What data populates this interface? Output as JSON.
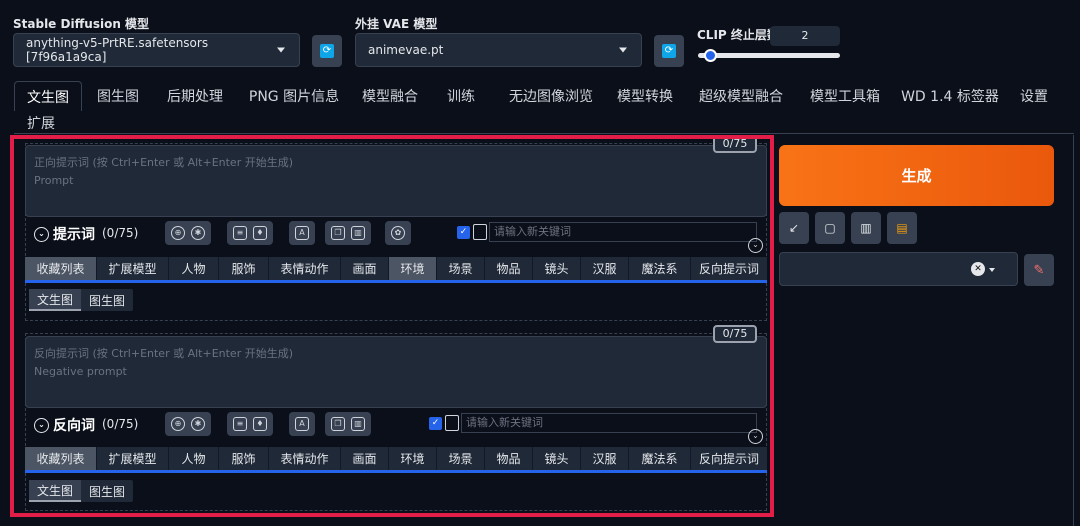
{
  "top": {
    "sd_model_label": "Stable Diffusion 模型",
    "sd_model_value": "anything-v5-PrtRE.safetensors [7f96a1a9ca]",
    "vae_label": "外挂 VAE 模型",
    "vae_value": "animevae.pt",
    "clip_label": "CLIP 终止层数",
    "clip_value": "2"
  },
  "tabs": [
    "文生图",
    "图生图",
    "后期处理",
    "PNG 图片信息",
    "模型融合",
    "训练",
    "无边图像浏览",
    "模型转换",
    "超级模型融合",
    "模型工具箱",
    "WD 1.4 标签器",
    "设置"
  ],
  "tab_extra": "扩展",
  "positive": {
    "counter": "0/75",
    "placeholder_line1": "正向提示词 (按 Ctrl+Enter 或 Alt+Enter 开始生成)",
    "placeholder_line2": "Prompt",
    "title": "提示词",
    "count": "(0/75)",
    "keyword_placeholder": "请输入新关键词"
  },
  "negative": {
    "counter": "0/75",
    "placeholder_line1": "反向提示词 (按 Ctrl+Enter 或 Alt+Enter 开始生成)",
    "placeholder_line2": "Negative prompt",
    "title": "反向词",
    "count": "(0/75)",
    "keyword_placeholder": "请输入新关键词"
  },
  "categories": [
    "收藏列表",
    "扩展模型",
    "人物",
    "服饰",
    "表情动作",
    "画面",
    "环境",
    "场景",
    "物品",
    "镜头",
    "汉服",
    "魔法系",
    "反向提示词"
  ],
  "subtabs": [
    "文生图",
    "图生图"
  ],
  "generate_label": "生成",
  "colors": {
    "accent": "#ea580c",
    "highlight": "#e11d48",
    "primary": "#2563eb"
  }
}
